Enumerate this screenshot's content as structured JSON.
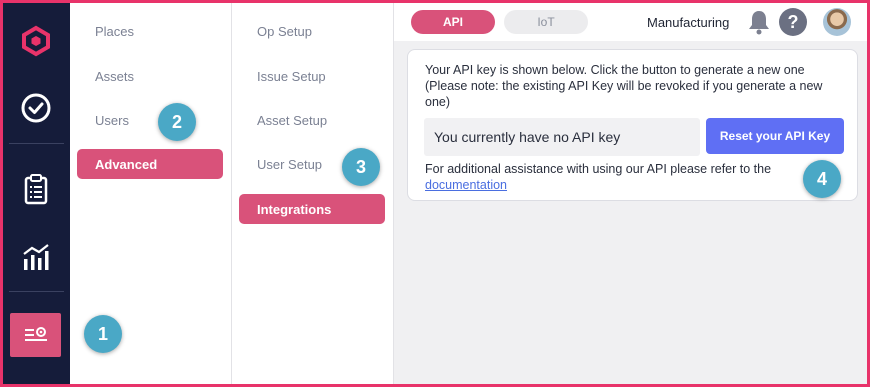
{
  "colors": {
    "accent": "#d9527a",
    "rail": "#151c3a",
    "primary_button": "#5f6ff4",
    "marker": "#4aa8c6",
    "frame": "#e8336a"
  },
  "rail": {
    "icons": [
      "app-logo-icon",
      "check-circle-icon",
      "clipboard-list-icon",
      "bar-chart-icon",
      "settings-sliders-icon"
    ]
  },
  "settings_nav": {
    "items": [
      "Places",
      "Assets",
      "Users"
    ],
    "active": "Advanced"
  },
  "advanced_nav": {
    "items": [
      "Op Setup",
      "Issue Setup",
      "Asset Setup",
      "User Setup"
    ],
    "active": "Integrations"
  },
  "header": {
    "tabs": {
      "api": "API",
      "iot": "IoT"
    },
    "selected_tab": "API",
    "workspace": "Manufacturing",
    "help_label": "?"
  },
  "api_card": {
    "intro": "Your API key is shown below. Click the button to generate a new one (Please note: the existing API Key will be revoked if you generate a new one)",
    "key_value": "You currently have no API key",
    "reset_label": "Reset your API Key",
    "assist_text": "For additional assistance with using our API please refer to the",
    "link_text": "documentation"
  },
  "markers": [
    "1",
    "2",
    "3",
    "4"
  ]
}
